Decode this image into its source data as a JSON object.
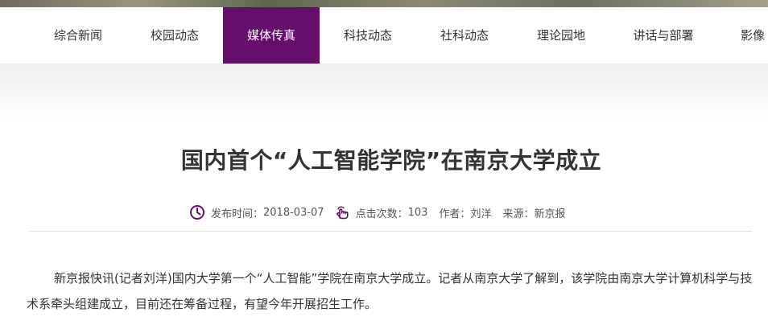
{
  "nav": {
    "items": [
      {
        "label": "综合新闻"
      },
      {
        "label": "校园动态"
      },
      {
        "label": "媒体传真",
        "active": true
      },
      {
        "label": "科技动态"
      },
      {
        "label": "社科动态"
      },
      {
        "label": "理论园地"
      },
      {
        "label": "讲话与部署"
      },
      {
        "label": "影像"
      }
    ],
    "active_color": "#660e6b"
  },
  "article": {
    "title": "国内首个“人工智能学院”在南京大学成立",
    "meta": {
      "publish_label": "发布时间：",
      "publish_date": "2018-03-07",
      "clicks_label": "点击次数：",
      "clicks": "103",
      "author_label": "作者：",
      "author": "刘洋",
      "source_label": "来源：",
      "source": "新京报"
    },
    "body": "新京报快讯(记者刘洋)国内大学第一个“人工智能”学院在南京大学成立。记者从南京大学了解到，该学院由南京大学计算机科学与技术系牵头组建成立，目前还在筹备过程，有望今年开展招生工作。"
  },
  "icons": {
    "clock": "clock-icon",
    "hand": "hand-pointer-icon"
  }
}
